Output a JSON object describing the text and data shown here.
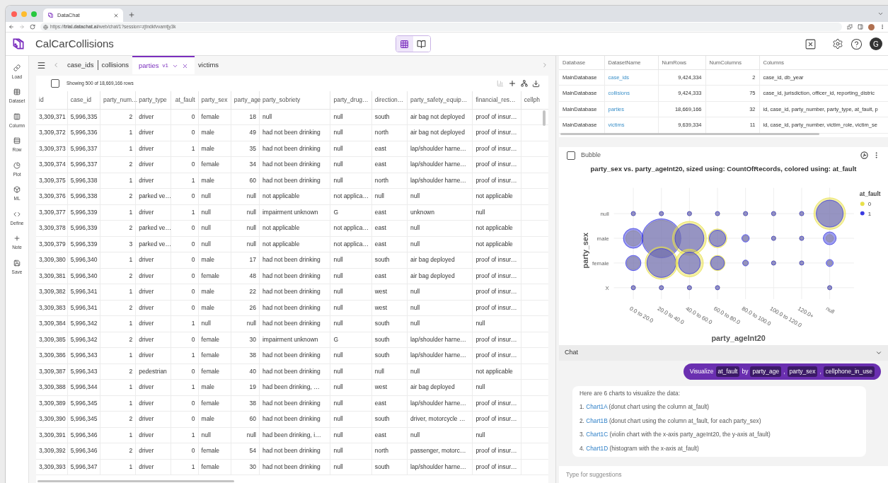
{
  "browser": {
    "tab_title": "DataChat",
    "url": "https://**trial.datachat.ai**/web/chat/1?session=zjtndkfvvamtjy3k"
  },
  "app": {
    "title": "CalCarCollisions",
    "views": [
      {
        "selected": true
      },
      {
        "selected": false
      }
    ],
    "avatar": "G"
  },
  "sidebar": [
    {
      "label": "Load"
    },
    {
      "label": "Dataset"
    },
    {
      "label": "Column"
    },
    {
      "label": "Row"
    },
    {
      "label": "Plot"
    },
    {
      "label": "ML"
    },
    {
      "label": "Define"
    },
    {
      "label": "Note"
    },
    {
      "label": "Save"
    }
  ],
  "tabs": [
    {
      "label": "case_ids",
      "selected": false
    },
    {
      "label": "collisions",
      "selected": false
    },
    {
      "label": "parties",
      "version": "v1",
      "selected": true
    },
    {
      "label": "victims",
      "selected": false
    }
  ],
  "toolbar": {
    "checked": false,
    "summary": "Showing 500 of 18,669,166 rows"
  },
  "table": {
    "columns": [
      "id",
      "case_id",
      "party_num…",
      "party_type",
      "at_fault",
      "party_sex",
      "party_age",
      "party_sobriety",
      "party_drug…",
      "direction…",
      "party_safety_equip…",
      "financial_res…",
      "cellph"
    ],
    "rows": [
      [
        "3,309,371",
        "5,996,335",
        "2",
        "driver",
        "0",
        "female",
        "18",
        "null",
        "null",
        "south",
        "air bag not deployed",
        "proof of insur…"
      ],
      [
        "3,309,372",
        "5,996,336",
        "1",
        "driver",
        "0",
        "male",
        "49",
        "had not been drinking",
        "null",
        "north",
        "air bag not deployed",
        "proof of insur…"
      ],
      [
        "3,309,373",
        "5,996,337",
        "1",
        "driver",
        "1",
        "male",
        "35",
        "had not been drinking",
        "null",
        "east",
        "lap/shoulder harne…",
        "proof of insur…"
      ],
      [
        "3,309,374",
        "5,996,337",
        "2",
        "driver",
        "0",
        "female",
        "34",
        "had not been drinking",
        "null",
        "east",
        "lap/shoulder harne…",
        "proof of insur…"
      ],
      [
        "3,309,375",
        "5,996,338",
        "1",
        "driver",
        "1",
        "male",
        "60",
        "had not been drinking",
        "null",
        "north",
        "lap/shoulder harne…",
        "proof of insur…"
      ],
      [
        "3,309,376",
        "5,996,338",
        "2",
        "parked ve…",
        "0",
        "null",
        "null",
        "not applicable",
        "not applica…",
        "null",
        "null",
        "not applicable"
      ],
      [
        "3,309,377",
        "5,996,339",
        "1",
        "driver",
        "1",
        "null",
        "null",
        "impairment unknown",
        "G",
        "east",
        "unknown",
        "null"
      ],
      [
        "3,309,378",
        "5,996,339",
        "2",
        "parked ve…",
        "0",
        "null",
        "null",
        "not applicable",
        "not applica…",
        "east",
        "null",
        "not applicable"
      ],
      [
        "3,309,379",
        "5,996,339",
        "3",
        "parked ve…",
        "0",
        "null",
        "null",
        "not applicable",
        "not applica…",
        "east",
        "null",
        "not applicable"
      ],
      [
        "3,309,380",
        "5,996,340",
        "1",
        "driver",
        "0",
        "male",
        "17",
        "had not been drinking",
        "null",
        "south",
        "air bag deployed",
        "proof of insur…"
      ],
      [
        "3,309,381",
        "5,996,340",
        "2",
        "driver",
        "0",
        "female",
        "48",
        "had not been drinking",
        "null",
        "east",
        "air bag deployed",
        "proof of insur…"
      ],
      [
        "3,309,382",
        "5,996,341",
        "1",
        "driver",
        "0",
        "male",
        "22",
        "had not been drinking",
        "null",
        "west",
        "null",
        "proof of insur…"
      ],
      [
        "3,309,383",
        "5,996,341",
        "2",
        "driver",
        "0",
        "male",
        "26",
        "had not been drinking",
        "null",
        "west",
        "null",
        "proof of insur…"
      ],
      [
        "3,309,384",
        "5,996,342",
        "1",
        "driver",
        "1",
        "null",
        "null",
        "had not been drinking",
        "null",
        "south",
        "null",
        "null"
      ],
      [
        "3,309,385",
        "5,996,342",
        "2",
        "driver",
        "0",
        "female",
        "30",
        "impairment unknown",
        "G",
        "south",
        "lap/shoulder harne…",
        "proof of insur…"
      ],
      [
        "3,309,386",
        "5,996,343",
        "1",
        "driver",
        "1",
        "female",
        "38",
        "had not been drinking",
        "null",
        "south",
        "lap/shoulder harne…",
        "proof of insur…"
      ],
      [
        "3,309,387",
        "5,996,343",
        "2",
        "pedestrian",
        "0",
        "female",
        "40",
        "had not been drinking",
        "null",
        "null",
        "null",
        "not applicable"
      ],
      [
        "3,309,388",
        "5,996,344",
        "1",
        "driver",
        "1",
        "male",
        "19",
        "had been drinking, …",
        "null",
        "west",
        "air bag deployed",
        "null"
      ],
      [
        "3,309,389",
        "5,996,345",
        "1",
        "driver",
        "0",
        "female",
        "38",
        "had not been drinking",
        "null",
        "east",
        "lap/shoulder harne…",
        "proof of insur…"
      ],
      [
        "3,309,390",
        "5,996,345",
        "2",
        "driver",
        "0",
        "male",
        "60",
        "had not been drinking",
        "null",
        "south",
        "driver, motorcycle …",
        "proof of insur…"
      ],
      [
        "3,309,391",
        "5,996,346",
        "1",
        "driver",
        "1",
        "null",
        "null",
        "had been drinking, i…",
        "null",
        "east",
        "null",
        "null"
      ],
      [
        "3,309,392",
        "5,996,346",
        "2",
        "driver",
        "0",
        "female",
        "54",
        "had not been drinking",
        "null",
        "north",
        "passenger, motorc…",
        "proof of insur…"
      ],
      [
        "3,309,393",
        "5,996,347",
        "1",
        "driver",
        "1",
        "female",
        "30",
        "had not been drinking",
        "null",
        "south",
        "lap/shoulder harne…",
        "proof of insur…"
      ]
    ]
  },
  "datasets": {
    "columns": [
      "Database",
      "DatasetName",
      "NumRows",
      "NumColumns",
      "Columns"
    ],
    "rows": [
      [
        "MainDatabase",
        "case_ids",
        "9,424,334",
        "2",
        "case_id, db_year"
      ],
      [
        "MainDatabase",
        "collisions",
        "9,424,333",
        "75",
        "case_id, jurisdiction, officer_id, reporting_distric"
      ],
      [
        "MainDatabase",
        "parties",
        "18,669,166",
        "32",
        "id, case_id, party_number, party_type, at_fault, p"
      ],
      [
        "MainDatabase",
        "victims",
        "9,639,334",
        "11",
        "id, case_id, party_number, victim_role, victim_se"
      ]
    ]
  },
  "chart_panel": {
    "label": "Bubble",
    "checked": false,
    "title": "party_sex vs. party_ageInt20, sized using: CountOfRecords, colored using: at_fault",
    "xlabel": "party_ageInt20",
    "ylabel": "party_sex",
    "x_labels": [
      "0.0 to 20.0",
      "20.0 to 40.0",
      "40.0 to 60.0",
      "60.0 to 80.0",
      "80.0 to 100.0",
      "100.0 to 120.0",
      "120.0+",
      "null"
    ],
    "y_labels": [
      "null",
      "male",
      "female",
      "X"
    ],
    "legend": {
      "title": "at_fault",
      "items": [
        {
          "label": "0",
          "color": "#e8e04a"
        },
        {
          "label": "1",
          "color": "#3a3ae0"
        }
      ]
    }
  },
  "chat": {
    "title": "Chat",
    "user_message": [
      {
        "kind": "text",
        "text": "Visualize"
      },
      {
        "kind": "chip",
        "text": "at_fault"
      },
      {
        "kind": "text",
        "text": "by"
      },
      {
        "kind": "chip",
        "text": "party_age"
      },
      {
        "kind": "text",
        "text": ","
      },
      {
        "kind": "chip",
        "text": "party_sex"
      },
      {
        "kind": "text",
        "text": ","
      },
      {
        "kind": "chip",
        "text": "cellphone_in_use"
      }
    ],
    "response": {
      "intro": "Here are 6 charts to visualize the data:",
      "items": [
        {
          "number": "1.",
          "link": "Chart1A",
          "text": "(donut chart using the column at_fault)"
        },
        {
          "number": "2.",
          "link": "Chart1B",
          "text": "(donut chart using the column at_fault, for each party_sex)"
        },
        {
          "number": "3.",
          "link": "Chart1C",
          "text": "(violin chart with the x-axis party_ageInt20, the y-axis at_fault)"
        },
        {
          "number": "4.",
          "link": "Chart1D",
          "text": "(histogram with the x-axis at_fault)"
        }
      ]
    },
    "input": {
      "placeholder": "Type for suggestions"
    }
  }
}
